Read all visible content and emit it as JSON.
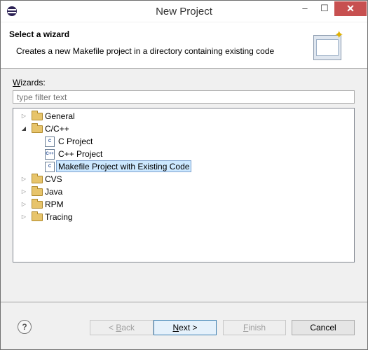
{
  "window": {
    "title": "New Project",
    "controls": {
      "minimize": "–",
      "maximize": "☐",
      "close": "✕"
    }
  },
  "header": {
    "title": "Select a wizard",
    "description": "Creates a new Makefile project in a directory containing existing code"
  },
  "wizards": {
    "label_first": "W",
    "label_rest": "izards:",
    "filter_placeholder": "type filter text",
    "tree": [
      {
        "label": "General",
        "expanded": false
      },
      {
        "label": "C/C++",
        "expanded": true
      },
      {
        "label": "C Project",
        "kind": "project",
        "icon_text": "C"
      },
      {
        "label": "C++ Project",
        "kind": "project",
        "icon_text": "C++"
      },
      {
        "label": "Makefile Project with Existing Code",
        "kind": "project",
        "icon_text": "C",
        "selected": true
      },
      {
        "label": "CVS",
        "expanded": false
      },
      {
        "label": "Java",
        "expanded": false
      },
      {
        "label": "RPM",
        "expanded": false
      },
      {
        "label": "Tracing",
        "expanded": false
      }
    ]
  },
  "buttons": {
    "help": "?",
    "back_first": "< ",
    "back_mnemonic": "B",
    "back_rest": "ack",
    "next_mnemonic": "N",
    "next_rest": "ext >",
    "finish_mnemonic": "F",
    "finish_rest": "inish",
    "cancel": "Cancel"
  },
  "colors": {
    "selection": "#cce8ff",
    "selection_border": "#7da2ce",
    "close_button": "#c75050"
  }
}
